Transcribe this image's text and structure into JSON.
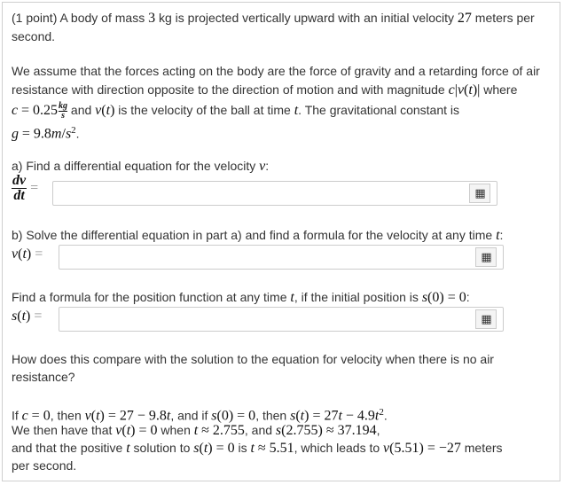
{
  "problem": {
    "intro_1": "(1 point) A body of mass 3 kg is projected vertically upward with an initial velocity 27 meters per",
    "intro_2": "second.",
    "assume_1": "We assume that the forces acting on the body are the force of gravity and a retarding force of air",
    "assume_2": "resistance with direction opposite to the direction of motion and with magnitude c|v(t)| where",
    "assume_3": "c = 0.25 kg/s and v(t) is the velocity of the ball at time t. The gravitational constant is",
    "assume_4": "g = 9.8m/s².",
    "part_a": "a) Find a differential equation for the velocity v:",
    "part_a_lhs": "dv/dt =",
    "part_b": "b) Solve the differential equation in part a) and find a formula for the velocity at any time t:",
    "part_b_lhs": "v(t) =",
    "part_c": "Find a formula for the position function at any time t, if the initial position is s(0) = 0:",
    "part_c_lhs": "s(t) =",
    "compare_1": "How does this compare with the solution to the equation for velocity when there is no air",
    "compare_2": "resistance?",
    "noair_1": "If c = 0, then v(t) = 27 − 9.8t, and if s(0) = 0, then s(t) = 27t − 4.9t².",
    "noair_2": "We then have that v(t) = 0 when t ≈ 2.755, and s(2.755) ≈ 37.194,",
    "noair_3": "and that the positive t solution to s(t) = 0 is t ≈ 5.51, which leads to v(5.51) = −27 meters",
    "noair_4": "per second."
  },
  "answers": {
    "a_value": "",
    "b_value": "",
    "c_value": ""
  },
  "icons": {
    "keyboard": "equation-editor-grid-icon"
  }
}
